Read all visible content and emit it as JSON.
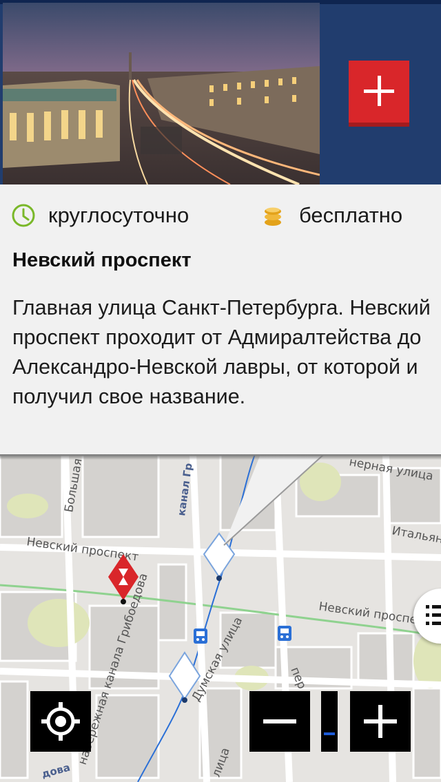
{
  "place": {
    "hours_label": "круглосуточно",
    "price_label": "бесплатно",
    "title": "Невский проспект",
    "description": "Главная улица Санкт-Петербурга. Невский проспект проходит от Адмиралтейства до Александро-Невской лавры, от которой и получил свое название."
  },
  "icons": {
    "hours": "clock-icon",
    "price": "coins-icon",
    "add": "plus-icon",
    "locate": "crosshair-icon",
    "menu": "list-icon",
    "marker": "hourglass-marker-icon",
    "metro": "metro-train-icon"
  },
  "map": {
    "labels": {
      "nevsky_west": "Невский проспект",
      "nevsky_east": "Невский проспе",
      "bolshaya": "Большая",
      "kanal_gr": "канал Гр",
      "italyanskaya": "Итальян",
      "zernaya": "нерная улица",
      "griboedova": "набережная канала Грибоедова",
      "dumskaya": "Думская улица",
      "per": "пер",
      "dova": "дова",
      "litsa": "лица"
    }
  },
  "colors": {
    "header_bg": "#213d6e",
    "accent_red": "#d9262a",
    "clock_green": "#7ab829",
    "coin_gold": "#e3a21a",
    "route_blue": "#2a6fd6",
    "metro_line_green": "#8fd28f"
  }
}
